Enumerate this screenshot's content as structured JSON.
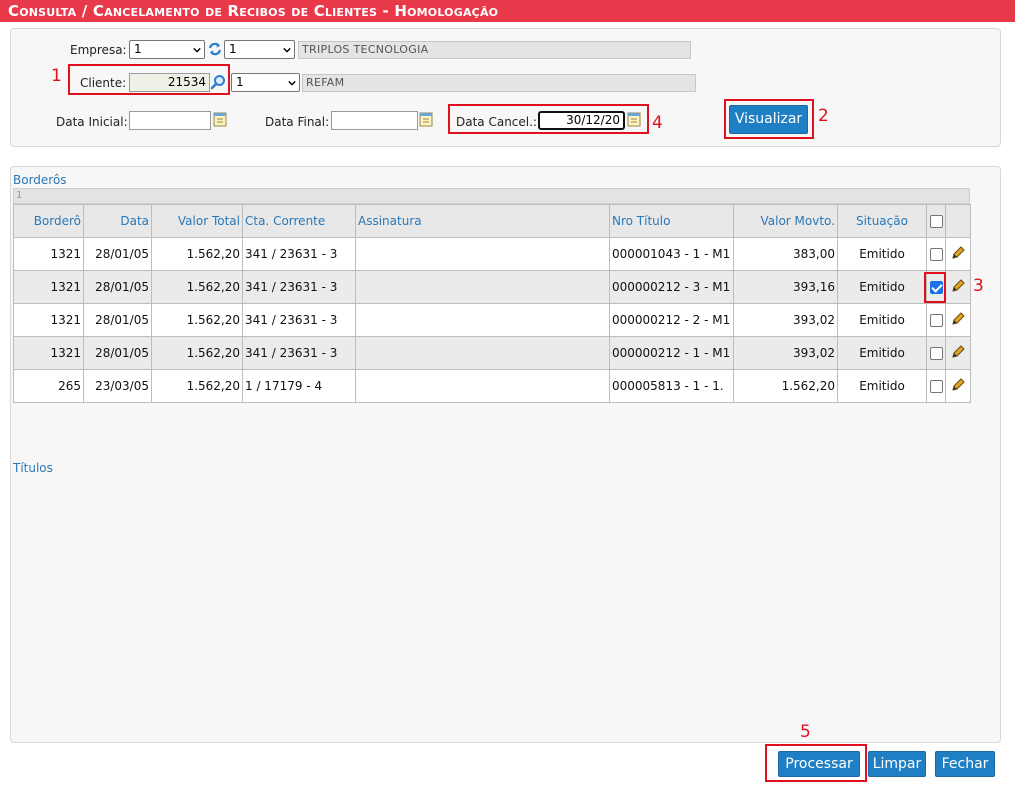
{
  "title": "Consulta / Cancelamento de Recibos de Clientes  - Homologação",
  "filters": {
    "empresa_label": "Empresa:",
    "empresa_value": "1",
    "empresa_sub_value": "1",
    "empresa_name": "TRIPLOS TECNOLOGIA",
    "cliente_label": "Cliente:",
    "cliente_value": "21534",
    "cliente_sub_value": "1",
    "cliente_name": "REFAM",
    "data_inicial_label": "Data Inicial:",
    "data_inicial_value": "",
    "data_final_label": "Data Final:",
    "data_final_value": "",
    "data_cancel_label": "Data Cancel.:",
    "data_cancel_value": "30/12/20"
  },
  "buttons": {
    "visualizar": "Visualizar",
    "processar": "Processar",
    "limpar": "Limpar",
    "fechar": "Fechar"
  },
  "annotations": [
    "1",
    "2",
    "3",
    "4",
    "5"
  ],
  "borderos": {
    "title": "Borderôs",
    "page": "1",
    "columns": {
      "bordero": "Borderô",
      "data": "Data",
      "valor_total": "Valor Total",
      "cta_corrente": "Cta. Corrente",
      "assinatura": "Assinatura",
      "nro_titulo": "Nro Título",
      "valor_movto": "Valor Movto.",
      "situacao": "Situação"
    },
    "rows": [
      {
        "bordero": "1321",
        "data": "28/01/05",
        "valor_total": "1.562,20",
        "cta_corrente": "341 / 23631 - 3",
        "assinatura": "",
        "nro_titulo": "000001043 - 1 - M1",
        "valor_movto": "383,00",
        "situacao": "Emitido",
        "checked": false
      },
      {
        "bordero": "1321",
        "data": "28/01/05",
        "valor_total": "1.562,20",
        "cta_corrente": "341 / 23631 - 3",
        "assinatura": "",
        "nro_titulo": "000000212 - 3 - M1",
        "valor_movto": "393,16",
        "situacao": "Emitido",
        "checked": true
      },
      {
        "bordero": "1321",
        "data": "28/01/05",
        "valor_total": "1.562,20",
        "cta_corrente": "341 / 23631 - 3",
        "assinatura": "",
        "nro_titulo": "000000212 - 2 - M1",
        "valor_movto": "393,02",
        "situacao": "Emitido",
        "checked": false
      },
      {
        "bordero": "1321",
        "data": "28/01/05",
        "valor_total": "1.562,20",
        "cta_corrente": "341 / 23631 - 3",
        "assinatura": "",
        "nro_titulo": "000000212 - 1 - M1",
        "valor_movto": "393,02",
        "situacao": "Emitido",
        "checked": false
      },
      {
        "bordero": "265",
        "data": "23/03/05",
        "valor_total": "1.562,20",
        "cta_corrente": "1 / 17179 - 4",
        "assinatura": "",
        "nro_titulo": "000005813 - 1 - 1.",
        "valor_movto": "1.562,20",
        "situacao": "Emitido",
        "checked": false
      }
    ]
  },
  "titulos": {
    "title": "Títulos"
  },
  "icons": {
    "refresh": "refresh-icon",
    "search": "search-icon",
    "calendar": "calendar-icon",
    "edit": "pencil-icon",
    "dropdown": "chevron-down-icon"
  }
}
